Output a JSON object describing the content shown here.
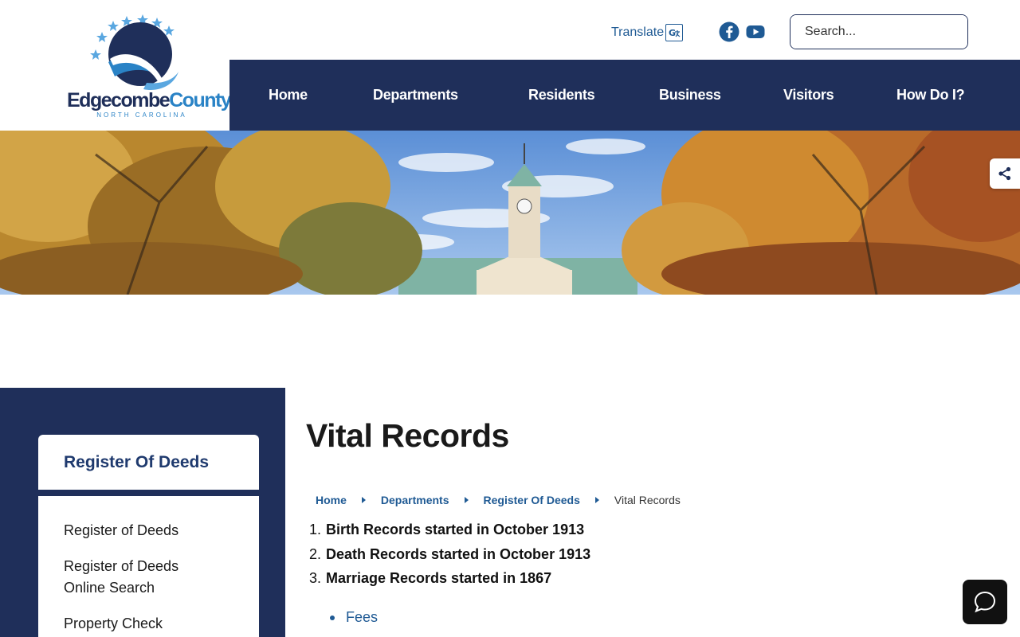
{
  "header": {
    "logo": {
      "name": "Edgecombe",
      "name_accent": "County",
      "sub": "NORTH CAROLINA"
    },
    "translate_label": "Translate",
    "search": {
      "placeholder": "Search..."
    }
  },
  "nav": {
    "items": [
      "Home",
      "Departments",
      "Residents",
      "Business",
      "Visitors",
      "How Do I?"
    ]
  },
  "sidebar": {
    "title": "Register Of Deeds",
    "links": [
      "Register of Deeds",
      "Register of Deeds Online Search",
      "Property Check"
    ]
  },
  "main": {
    "title": "Vital Records",
    "breadcrumb": {
      "links": [
        "Home",
        "Departments",
        "Register Of Deeds"
      ],
      "current": "Vital Records"
    },
    "records": [
      {
        "num": "1.",
        "text": "Birth Records started in October 1913"
      },
      {
        "num": "2.",
        "text": "Death Records started in October 1913"
      },
      {
        "num": "3.",
        "text": "Marriage Records started in 1867"
      }
    ],
    "links": [
      "Fees"
    ]
  },
  "colors": {
    "navy": "#1f2f5a",
    "link_blue": "#1f5a94",
    "search_button": "#2a6db0"
  }
}
